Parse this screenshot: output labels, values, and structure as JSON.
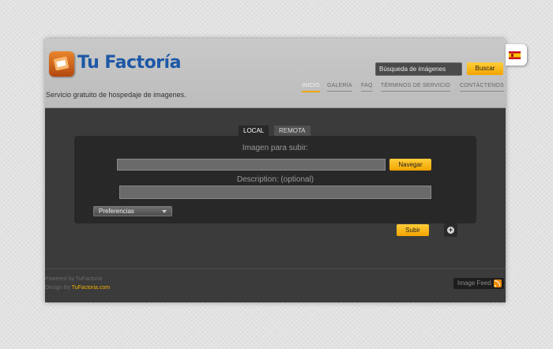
{
  "header": {
    "logo_part1": "Tu ",
    "logo_part2": "Factoría",
    "tagline": "Servicio gratuito de hospedaje de imagenes.",
    "search_placeholder": "Búsqueda de imágenes",
    "search_button": "Buscar"
  },
  "nav": {
    "items": [
      {
        "label": "INICIO",
        "active": true
      },
      {
        "label": "GALERÍA",
        "active": false
      },
      {
        "label": "FAQ",
        "active": false
      },
      {
        "label": "TÉRMINOS DE SERVICIO",
        "active": false
      },
      {
        "label": "CONTÁCTENOS",
        "active": false
      }
    ]
  },
  "language": {
    "flag_icon": "spain-flag-icon"
  },
  "upload": {
    "tabs": [
      "LOCAL",
      "REMOTA"
    ],
    "image_label": "Imagen para subir:",
    "browse_button": "Navegar",
    "description_label": "Description: (optional)",
    "preferences_select": "Preferencias",
    "submit_button": "Subir",
    "add_icon": "add-circle-icon"
  },
  "footer": {
    "powered_by": "Powered by TuFactoria",
    "design_by_prefix": "Design By ",
    "design_by_link": "TuFactoria.com",
    "image_feed": "Image Feed"
  },
  "colors": {
    "accent": "#f2a400",
    "logo_blue": "#1c58a6",
    "header_bg": "#c4c4c4",
    "main_bg": "#3b3b3b",
    "panel_bg": "#282828"
  }
}
